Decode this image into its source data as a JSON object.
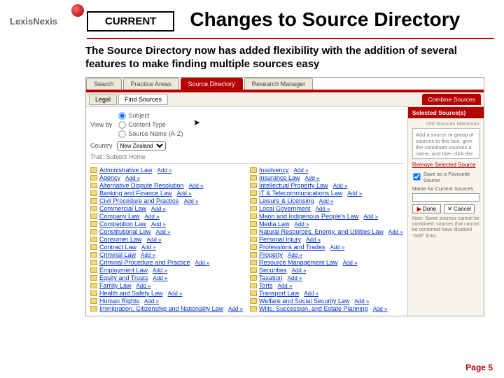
{
  "brand": "LexisNexis",
  "badge": "CURRENT",
  "title": "Changes to Source Directory",
  "intro": "The Source Directory now has added flexibility with the addition of several features to make finding multiple sources easy",
  "tabs_primary": [
    "Search",
    "Practice Areas",
    "Source Directory",
    "Research Manager"
  ],
  "tabs_primary_active": 2,
  "tabs_secondary": [
    "Legal",
    "Find Sources"
  ],
  "combine_label": "Combine Sources",
  "filters": {
    "label": "View by",
    "options": [
      "Subject",
      "Content Type",
      "Source Name (A-Z)"
    ],
    "selected": 0
  },
  "country": {
    "label": "Country",
    "value": "New Zealand"
  },
  "trail": {
    "label": "Trail:",
    "value": "Subject Home"
  },
  "add_label": "Add »",
  "categories_left": [
    "Administrative Law",
    "Agency",
    "Alternative Dispute Resolution",
    "Banking and Finance Law",
    "Civil Procedure and Practice",
    "Commercial Law",
    "Company Law",
    "Competition Law",
    "Constitutional Law",
    "Consumer Law",
    "Contract Law",
    "Criminal Law",
    "Criminal Procedure and Practice",
    "Employment Law",
    "Equity and Trusts",
    "Family Law",
    "Health and Safety Law",
    "Human Rights",
    "Immigration, Citizenship and Nationality Law"
  ],
  "categories_right": [
    "Insolvency",
    "Insurance Law",
    "Intellectual Property Law",
    "IT & Telecommunications Law",
    "Leisure & Licensing",
    "Local Government",
    "Maori and Indigenous People's Law",
    "Media Law",
    "Natural Resources, Energy, and Utilities Law",
    "Personal Injury",
    "Professions and Trades",
    "Property",
    "Resource Management Law",
    "Securities",
    "Taxation",
    "Torts",
    "Transport Law",
    "Welfare and Social Security Law",
    "Wills, Succession, and Estate Planning"
  ],
  "sidebar": {
    "title": "Selected Source(s)",
    "max": "200 Sources Maximum",
    "placeholder": "Add a source or group of sources to this box, give the combined sources a name, and then click the Done button.",
    "remove": "Remove Selected Source",
    "favourite": "Save as a Favourite Source",
    "name_label": "Name for Current Sources",
    "done": "Done",
    "cancel": "Cancel",
    "note": "Note: Some sources cannot be combined; sources that cannot be combined have disabled \"Add\" links."
  },
  "footer": "Page 5"
}
